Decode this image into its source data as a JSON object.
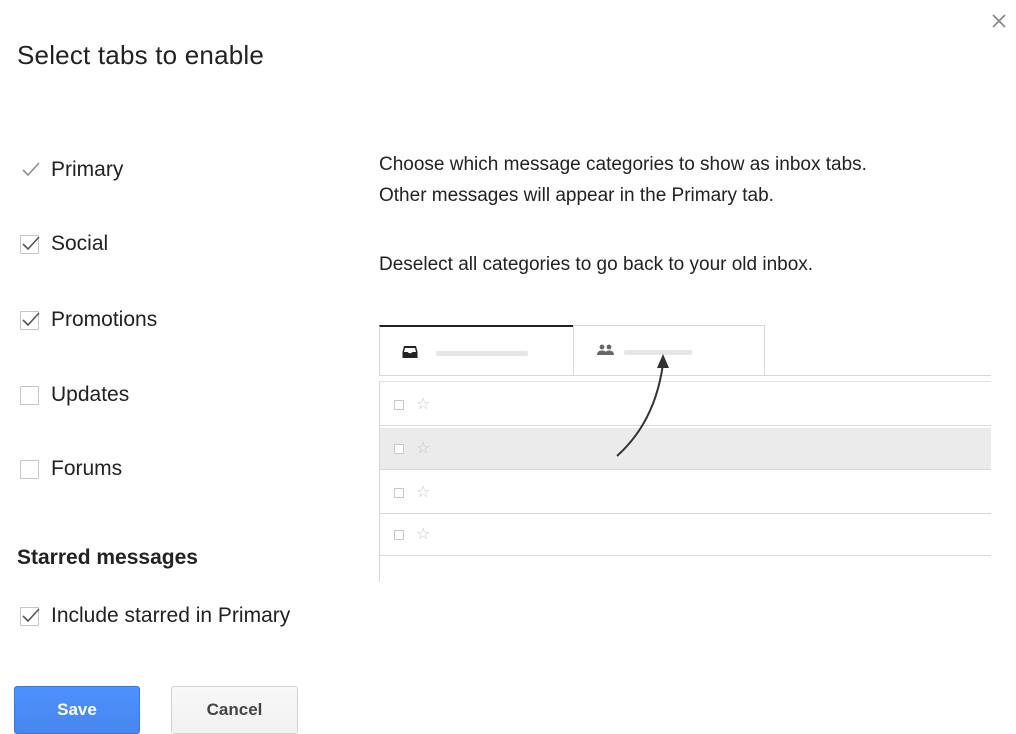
{
  "dialog": {
    "title": "Select tabs to enable"
  },
  "tabs_options": [
    {
      "label": "Primary",
      "checked": true,
      "disabled": true
    },
    {
      "label": "Social",
      "checked": true,
      "disabled": false
    },
    {
      "label": "Promotions",
      "checked": true,
      "disabled": false
    },
    {
      "label": "Updates",
      "checked": false,
      "disabled": false
    },
    {
      "label": "Forums",
      "checked": false,
      "disabled": false
    }
  ],
  "starred": {
    "heading": "Starred messages",
    "option_label": "Include starred in Primary",
    "checked": true
  },
  "description": {
    "line1": "Choose which message categories to show as inbox tabs.",
    "line2": "Other messages will appear in the Primary tab.",
    "line3": "Deselect all categories to go back to your old inbox."
  },
  "buttons": {
    "save_label": "Save",
    "cancel_label": "Cancel"
  },
  "illustration": {
    "tabs": [
      {
        "icon": "inbox-icon"
      },
      {
        "icon": "people-icon"
      }
    ],
    "row_count": 4,
    "highlighted_row": 1
  },
  "colors": {
    "save_button": "#4d90fe",
    "checkmark": "#555555"
  }
}
